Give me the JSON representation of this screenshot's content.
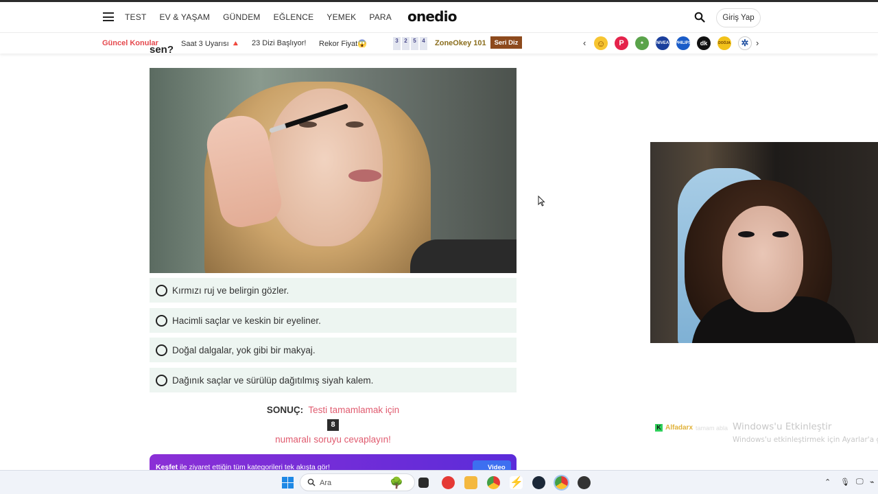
{
  "header": {
    "nav": [
      "TEST",
      "EV & YAŞAM",
      "GÜNDEM",
      "EĞLENCE",
      "YEMEK",
      "PARA"
    ],
    "logo": "onedio",
    "login": "Giriş Yap"
  },
  "trend": {
    "hot": "Güncel Konular",
    "items": [
      "Saat 3 Uyarısı 🔺",
      "23 Dizi Başlıyor!",
      "Rekor Fiyat😱"
    ],
    "zone_digits": [
      "3",
      "2",
      "5",
      "4"
    ],
    "zone_label": "ZoneOkey 101",
    "seri_badge": "Seri Diz",
    "brand_labels": [
      "NIVEA",
      "PHILIPS",
      "dk",
      "DOÖJA"
    ]
  },
  "quiz": {
    "cutoff_text": "sen?",
    "options": [
      "Kırmızı ruj ve belirgin gözler.",
      "Hacimli saçlar ve keskin bir eyeliner.",
      "Doğal dalgalar, yok gibi bir makyaj.",
      "Dağınık saçlar ve sürülüp dağıtılmış siyah kalem."
    ],
    "result_label": "SONUÇ:",
    "result_text": "Testi tamamlamak için",
    "result_number": "8",
    "result_text2": "numaralı soruyu cevaplayın!"
  },
  "banner": {
    "bold": "Keşfet",
    "text": " ile ziyaret ettiğin tüm kategorileri tek akışta gör!",
    "video": "Video"
  },
  "overlay": {
    "activate_title": "Windows'u Etkinleştir",
    "activate_sub": "Windows'u etkinleştirmek için Ayarlar'a gidi",
    "kick_user": "Alfadarx",
    "kick_msg": "tamam abla"
  },
  "taskbar": {
    "search_placeholder": "Ara"
  },
  "colors": {
    "option_bg": "#edf5f1",
    "accent_pink": "#e05b6f",
    "hot_red": "#e5484d",
    "banner_purple": "#8b2fd6"
  }
}
